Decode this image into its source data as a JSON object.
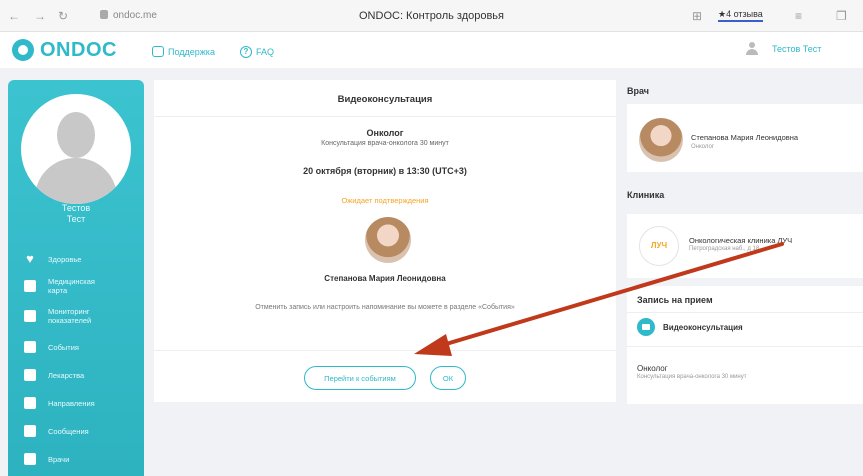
{
  "browser": {
    "url": "ondoc.me",
    "tab_title": "ONDOC: Контроль здоровья",
    "reviews_label": "★4 отзыва",
    "back_icon": "back-arrow-icon",
    "forward_icon": "forward-arrow-icon",
    "reload_icon": "reload-icon",
    "lock_icon": "lock-icon",
    "extension_icon": "extension-icon"
  },
  "header": {
    "logo": "ONDOC",
    "support_label": "Поддержка",
    "faq_label": "FAQ",
    "user_name": "Тестов Тест",
    "accent_color": "#2fb9c9"
  },
  "sidebar": {
    "user_first": "Тестов",
    "user_last": "Тест",
    "items": [
      {
        "label": "Здоровье",
        "icon": "heart-icon"
      },
      {
        "label": "Медицинская карта",
        "icon": "medical-card-icon"
      },
      {
        "label": "Мониторинг показателей",
        "icon": "monitoring-icon"
      },
      {
        "label": "События",
        "icon": "events-icon"
      },
      {
        "label": "Лекарства",
        "icon": "medicine-icon"
      },
      {
        "label": "Направления",
        "icon": "referrals-icon"
      },
      {
        "label": "Сообщения",
        "icon": "messages-icon"
      },
      {
        "label": "Врачи",
        "icon": "doctors-icon"
      }
    ]
  },
  "main": {
    "title": "Видеоконсультация",
    "specialty": "Онколог",
    "specialty_sub": "Консультация врача-онколога 30 минут",
    "datetime": "20 октября (вторник) в 13:30 (UTC+3)",
    "status": "Ожидает подтверждения",
    "doctor_name": "Степанова Мария Леонидовна",
    "hint": "Отменить запись или настроить напоминание вы можете в разделе «События»",
    "btn_events": "Перейти к событиям",
    "btn_ok": "ОК",
    "status_color": "#f5a623"
  },
  "right": {
    "doctor_heading": "Врач",
    "doctor_name": "Степанова Мария Леонидовна",
    "doctor_role": "Онколог",
    "clinic_heading": "Клиника",
    "clinic_logo": "ЛУЧ",
    "clinic_name": "Онкологическая клиника ЛУЧ",
    "clinic_address": "Петроградская наб., д 18",
    "appointment_heading": "Запись на прием",
    "appointment_type": "Видеоконсультация",
    "appointment_spec": "Онколог",
    "appointment_sub": "Консультация врача-онколога 30 минут"
  },
  "annotation": {
    "arrow_color": "#c0391b"
  }
}
